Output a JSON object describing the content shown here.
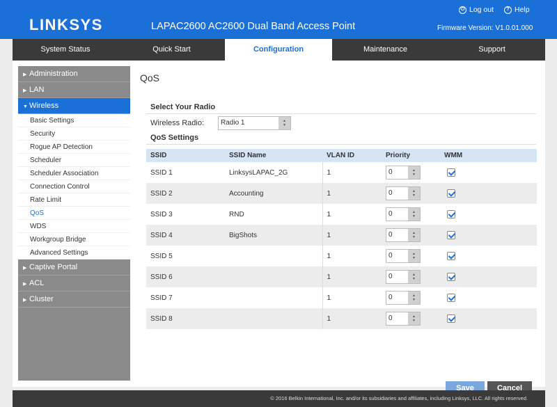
{
  "header": {
    "logo": "LINKSYS",
    "product": "LAPAC2600 AC2600 Dual Band Access Point",
    "logout": "Log out",
    "help": "Help",
    "firmware": "Firmware Version: V1.0.01.000"
  },
  "tabs": [
    {
      "label": "System Status",
      "active": false
    },
    {
      "label": "Quick Start",
      "active": false
    },
    {
      "label": "Configuration",
      "active": true
    },
    {
      "label": "Maintenance",
      "active": false
    },
    {
      "label": "Support",
      "active": false
    }
  ],
  "sidebar": {
    "administration": "Administration",
    "lan": "LAN",
    "wireless": "Wireless",
    "wireless_items": [
      "Basic Settings",
      "Security",
      "Rogue AP Detection",
      "Scheduler",
      "Scheduler Association",
      "Connection Control",
      "Rate Limit",
      "QoS",
      "WDS",
      "Workgroup Bridge",
      "Advanced Settings"
    ],
    "active_item": "QoS",
    "captive_portal": "Captive Portal",
    "acl": "ACL",
    "cluster": "Cluster"
  },
  "page": {
    "title": "QoS",
    "select_radio_title": "Select Your Radio",
    "radio_label": "Wireless Radio:",
    "radio_value": "Radio 1",
    "qos_settings_title": "QoS Settings"
  },
  "table": {
    "headers": [
      "SSID",
      "SSID Name",
      "VLAN ID",
      "Priority",
      "WMM"
    ],
    "rows": [
      {
        "ssid": "SSID 1",
        "name": "LinksysLAPAC_2G",
        "vlan": "1",
        "priority": "0",
        "wmm": true
      },
      {
        "ssid": "SSID 2",
        "name": "Accounting",
        "vlan": "1",
        "priority": "0",
        "wmm": true
      },
      {
        "ssid": "SSID 3",
        "name": "RND",
        "vlan": "1",
        "priority": "0",
        "wmm": true
      },
      {
        "ssid": "SSID 4",
        "name": "BigShots",
        "vlan": "1",
        "priority": "0",
        "wmm": true
      },
      {
        "ssid": "SSID 5",
        "name": "",
        "vlan": "1",
        "priority": "0",
        "wmm": true
      },
      {
        "ssid": "SSID 6",
        "name": "",
        "vlan": "1",
        "priority": "0",
        "wmm": true
      },
      {
        "ssid": "SSID 7",
        "name": "",
        "vlan": "1",
        "priority": "0",
        "wmm": true
      },
      {
        "ssid": "SSID 8",
        "name": "",
        "vlan": "1",
        "priority": "0",
        "wmm": true
      }
    ]
  },
  "buttons": {
    "save": "Save",
    "cancel": "Cancel"
  },
  "footer": "© 2016 Belkin International, Inc. and/or its subsidiaries and affiliates, including Linksys, LLC. All rights reserved.",
  "colors": {
    "brand_blue": "#1a70d6",
    "tab_bar": "#3a3a3a",
    "sidebar_gray": "#8a8a8a",
    "table_header": "#d7e4f5"
  }
}
